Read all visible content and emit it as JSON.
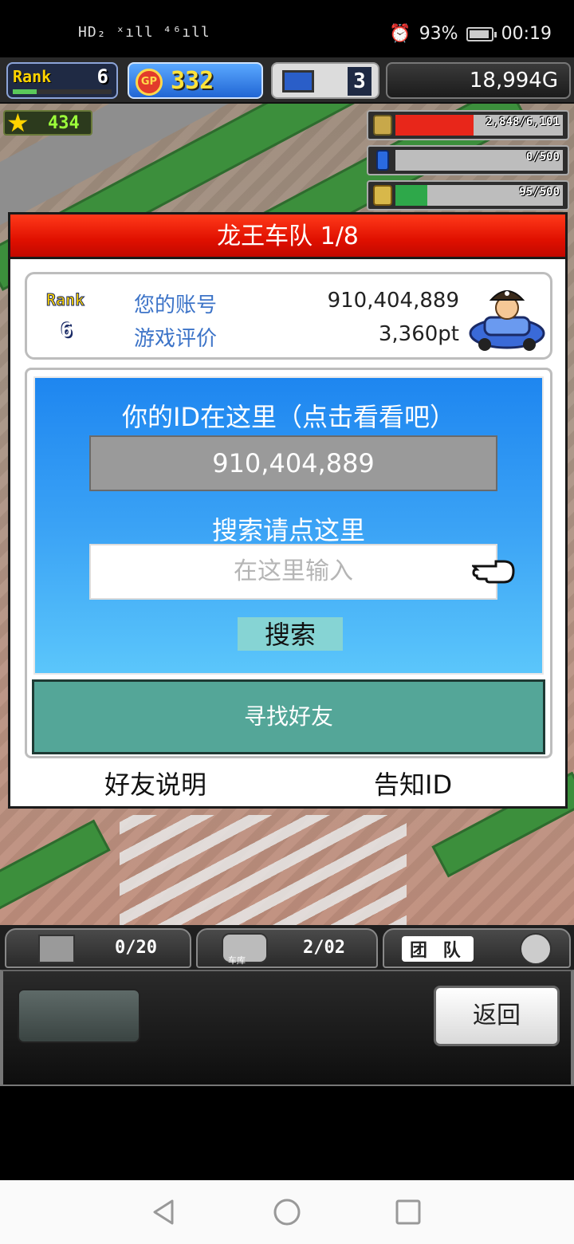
{
  "status_bar": {
    "network_text": "HD₂ ˣıll ⁴⁶ıll",
    "battery_percent": "93%",
    "time": "00:19",
    "battery_level": 0.93
  },
  "hud": {
    "rank_label": "Rank",
    "rank_value": "6",
    "gp_icon_text": "GP",
    "gp_value": "332",
    "research_value": "3",
    "money": "18,994G",
    "star_value": "434",
    "resources": [
      {
        "icon": "coin-stack-icon",
        "text": "2,848/6,101",
        "fill": 0.467,
        "color": "#e8261a"
      },
      {
        "icon": "fuel-can-icon",
        "text": "0/500",
        "fill": 0.0,
        "color": "#2a6ae0"
      },
      {
        "icon": "wheat-icon",
        "text": "95/500",
        "fill": 0.19,
        "color": "#2ea84a"
      }
    ]
  },
  "dialog": {
    "title": "龙王车队 1/8",
    "account": {
      "rank_label": "Rank",
      "rank_value": "6",
      "id_label": "您的账号",
      "id_value": "910,404,889",
      "score_label": "游戏评价",
      "score_value": "3,360pt"
    },
    "search": {
      "id_title": "你的ID在这里（点击看看吧）",
      "id_value": "910,404,889",
      "search_hint": "搜索请点这里",
      "input_placeholder": "在这里输入",
      "search_button": "搜索",
      "find_friend_button": "寻找好友"
    },
    "footer": {
      "friend_info": "好友说明",
      "share_id": "告知ID"
    }
  },
  "bottom_hud": {
    "tab1_count": "0/20",
    "tab2_label": "车库",
    "tab2_count": "2/02",
    "tab3_label": "团 队",
    "back_button": "返回"
  }
}
